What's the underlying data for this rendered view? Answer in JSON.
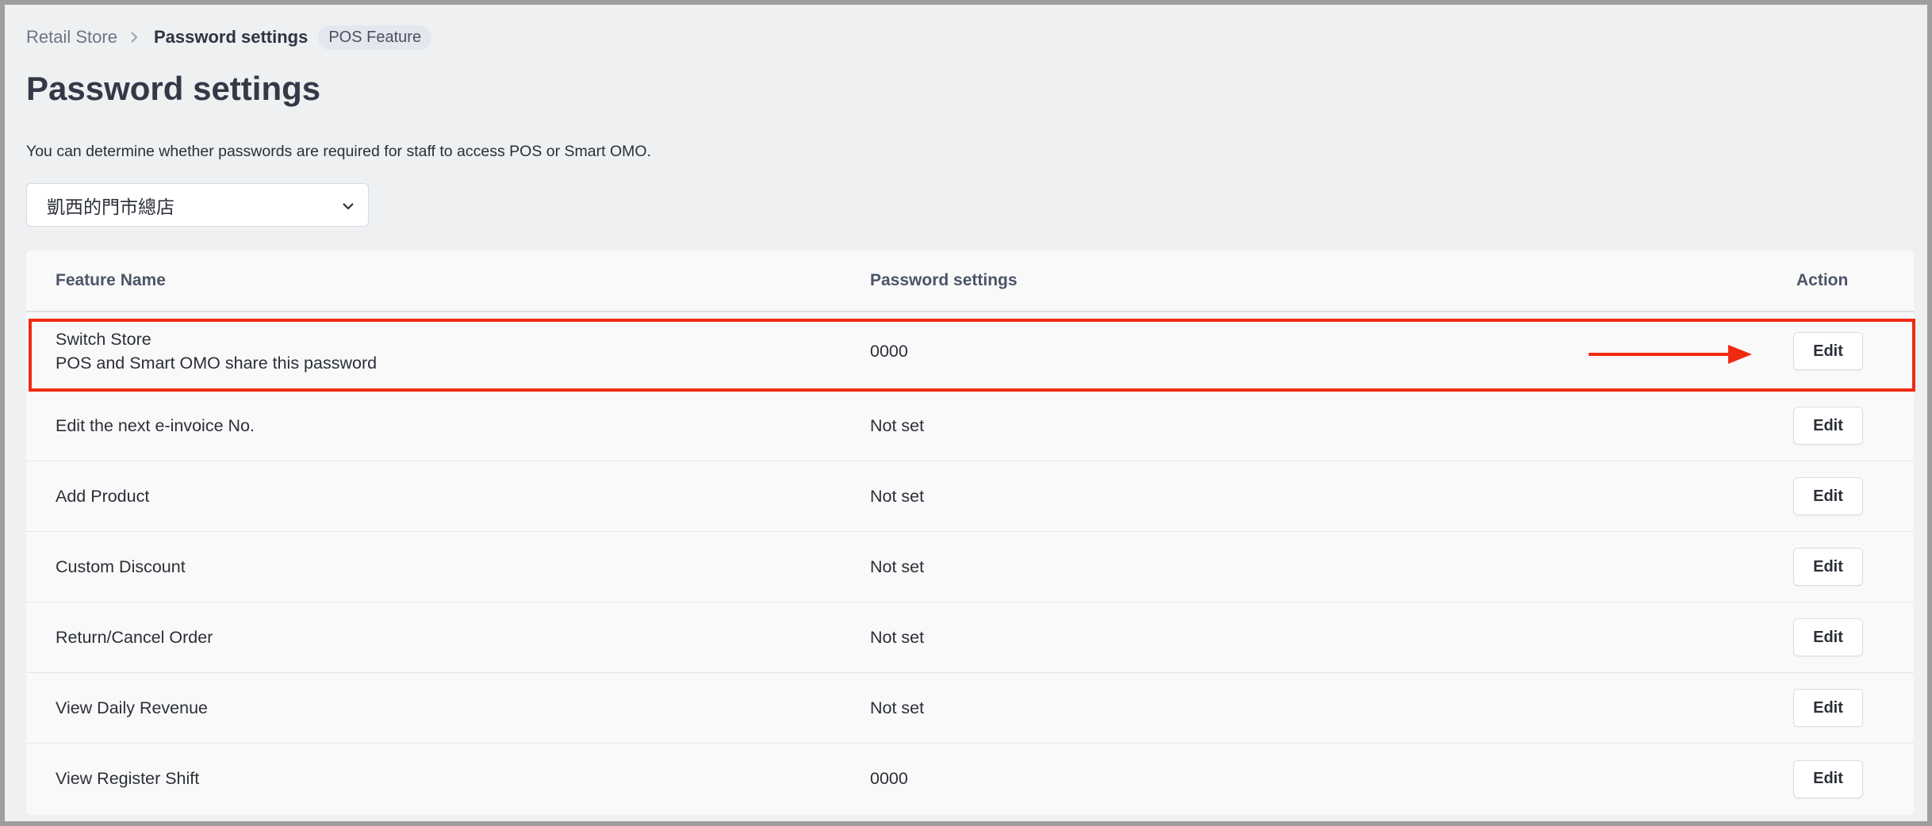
{
  "breadcrumb": {
    "root": "Retail Store",
    "current": "Password settings",
    "badge": "POS Feature"
  },
  "page": {
    "title": "Password settings",
    "description": "You can determine whether passwords are required for staff to access POS or Smart OMO."
  },
  "store_select": {
    "value": "凱西的門市總店"
  },
  "table": {
    "headers": {
      "feature_name": "Feature Name",
      "password_settings": "Password settings",
      "action": "Action"
    },
    "rows": [
      {
        "name": "Switch Store",
        "subtitle": "POS and Smart OMO share this password",
        "password": "0000",
        "action": "Edit"
      },
      {
        "name": "Edit the next e-invoice No.",
        "password": "Not set",
        "action": "Edit"
      },
      {
        "name": "Add Product",
        "password": "Not set",
        "action": "Edit"
      },
      {
        "name": "Custom Discount",
        "password": "Not set",
        "action": "Edit"
      },
      {
        "name": "Return/Cancel Order",
        "password": "Not set",
        "action": "Edit"
      },
      {
        "name": "View Daily Revenue",
        "password": "Not set",
        "action": "Edit"
      },
      {
        "name": "View Register Shift",
        "password": "0000",
        "action": "Edit"
      }
    ]
  },
  "annotation": {
    "highlight_color": "#f02a12"
  }
}
